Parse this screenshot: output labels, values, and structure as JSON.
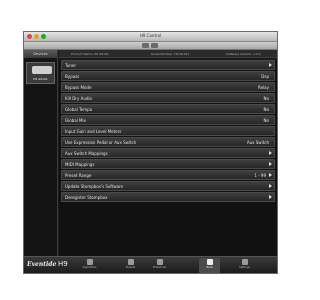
{
  "window": {
    "title": "H9 Control"
  },
  "sidebar": {
    "header": "Devices",
    "device_name": "H9 90191"
  },
  "info": {
    "product_label": "Product Name: H9 90191",
    "serial_label": "Serial Number: H9 90191",
    "software_label": "Software Version: 1.0.0"
  },
  "settings": {
    "rows": [
      {
        "label": "Tuner",
        "value": "",
        "chevron": true
      },
      {
        "label": "Bypass",
        "value": "Dsp",
        "chevron": false
      },
      {
        "label": "Bypass Mode",
        "value": "Relay",
        "chevron": false
      },
      {
        "label": "Kill Dry Audio",
        "value": "No",
        "chevron": false
      },
      {
        "label": "Global Tempo",
        "value": "No",
        "chevron": false
      },
      {
        "label": "Global Mix",
        "value": "No",
        "chevron": false
      },
      {
        "label": "Input Gain and Level Meters",
        "value": "",
        "chevron": false
      },
      {
        "label": "Use Expression Pedal or Aux Switch",
        "value": "Aux Switch",
        "chevron": false
      },
      {
        "label": "Aux Switch Mappings",
        "value": "",
        "chevron": true
      },
      {
        "label": "MIDI Mappings",
        "value": "",
        "chevron": true
      },
      {
        "label": "Preset Range",
        "value": "1 - 99",
        "chevron": true
      },
      {
        "label": "Update Stompbox's Software",
        "value": "",
        "chevron": true
      },
      {
        "label": "Deregister Stompbox",
        "value": "",
        "chevron": true
      }
    ]
  },
  "footer": {
    "brand": "Eventide",
    "model": "H9",
    "tabs": [
      {
        "label": "Algorithms",
        "icon": "algorithms-icon",
        "active": false
      },
      {
        "label": "Presets",
        "icon": "presets-icon",
        "active": false
      },
      {
        "label": "Preset List",
        "icon": "preset-list-icon",
        "active": false
      },
      {
        "label": "Tools",
        "icon": "tools-icon",
        "active": true
      },
      {
        "label": "Settings",
        "icon": "settings-icon",
        "active": false
      }
    ]
  }
}
